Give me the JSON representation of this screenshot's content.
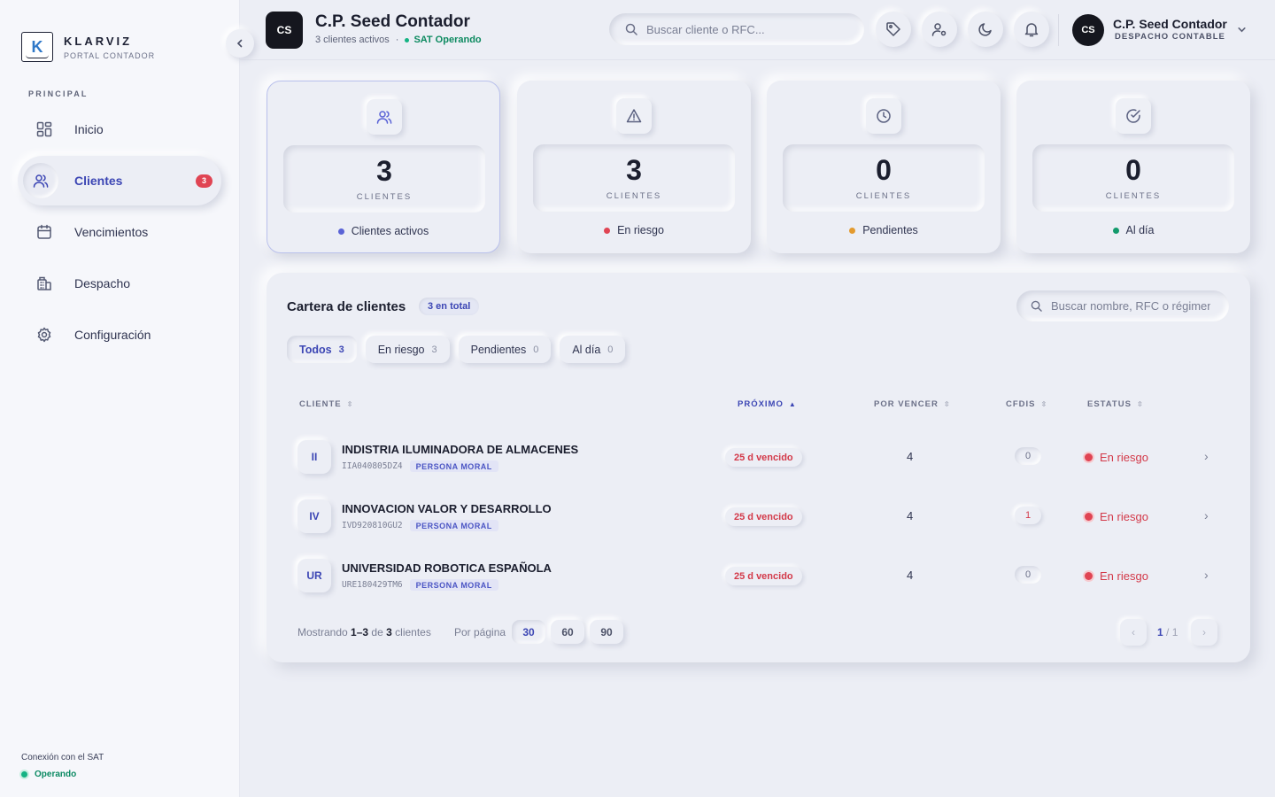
{
  "brand": {
    "name": "KLARVIZ",
    "subtitle": "PORTAL CONTADOR",
    "mark": "K"
  },
  "sidebar": {
    "section_label": "PRINCIPAL",
    "items": [
      {
        "label": "Inicio",
        "icon": "grid-icon"
      },
      {
        "label": "Clientes",
        "icon": "users-icon",
        "badge": "3"
      },
      {
        "label": "Vencimientos",
        "icon": "calendar-icon"
      },
      {
        "label": "Despacho",
        "icon": "building-icon"
      },
      {
        "label": "Configuración",
        "icon": "gear-icon"
      }
    ],
    "sat_title": "Conexión con el SAT",
    "sat_status": "Operando"
  },
  "header": {
    "initials": "CS",
    "title": "C.P. Seed Contador",
    "subtitle": "3 clientes activos",
    "separator": "·",
    "sat": "SAT Operando",
    "search_placeholder": "Buscar cliente o RFC...",
    "user_initials": "CS",
    "user_name": "C.P. Seed Contador",
    "user_role": "DESPACHO CONTABLE"
  },
  "stats": [
    {
      "value": "3",
      "unit": "CLIENTES",
      "label": "Clientes activos",
      "color": "#5a63d6",
      "icon": "users-icon"
    },
    {
      "value": "3",
      "unit": "CLIENTES",
      "label": "En riesgo",
      "color": "#e04453",
      "icon": "alert-triangle-icon"
    },
    {
      "value": "0",
      "unit": "CLIENTES",
      "label": "Pendientes",
      "color": "#e39a2e",
      "icon": "clock-icon"
    },
    {
      "value": "0",
      "unit": "CLIENTES",
      "label": "Al día",
      "color": "#139a6c",
      "icon": "check-circle-icon"
    }
  ],
  "portfolio": {
    "title": "Cartera de clientes",
    "total_pill": "3 en total",
    "search_placeholder": "Buscar nombre, RFC o régimen",
    "filters": [
      {
        "label": "Todos",
        "count": "3"
      },
      {
        "label": "En riesgo",
        "count": "3"
      },
      {
        "label": "Pendientes",
        "count": "0"
      },
      {
        "label": "Al día",
        "count": "0"
      }
    ],
    "columns": [
      "CLIENTE",
      "PRÓXIMO",
      "POR VENCER",
      "CFDIS",
      "ESTATUS"
    ],
    "rows": [
      {
        "initials": "II",
        "name": "INDISTRIA ILUMINADORA DE ALMACENES",
        "rfc": "IIA040805DZ4",
        "type": "PERSONA MORAL",
        "next": "25 d vencido",
        "due": "4",
        "cfdis": "0",
        "status": "En riesgo"
      },
      {
        "initials": "IV",
        "name": "INNOVACION VALOR Y DESARROLLO",
        "rfc": "IVD920810GU2",
        "type": "PERSONA MORAL",
        "next": "25 d vencido",
        "due": "4",
        "cfdis": "1",
        "status": "En riesgo"
      },
      {
        "initials": "UR",
        "name": "UNIVERSIDAD ROBOTICA ESPAÑOLA",
        "rfc": "URE180429TM6",
        "type": "PERSONA MORAL",
        "next": "25 d vencido",
        "due": "4",
        "cfdis": "0",
        "status": "En riesgo"
      }
    ],
    "footer": {
      "showing_prefix": "Mostrando",
      "range": "1–3",
      "of": "de",
      "total": "3",
      "suffix": "clientes",
      "per_page_label": "Por página",
      "per_page_options": [
        "30",
        "60",
        "90"
      ],
      "page_current": "1",
      "page_total": "/ 1"
    }
  }
}
